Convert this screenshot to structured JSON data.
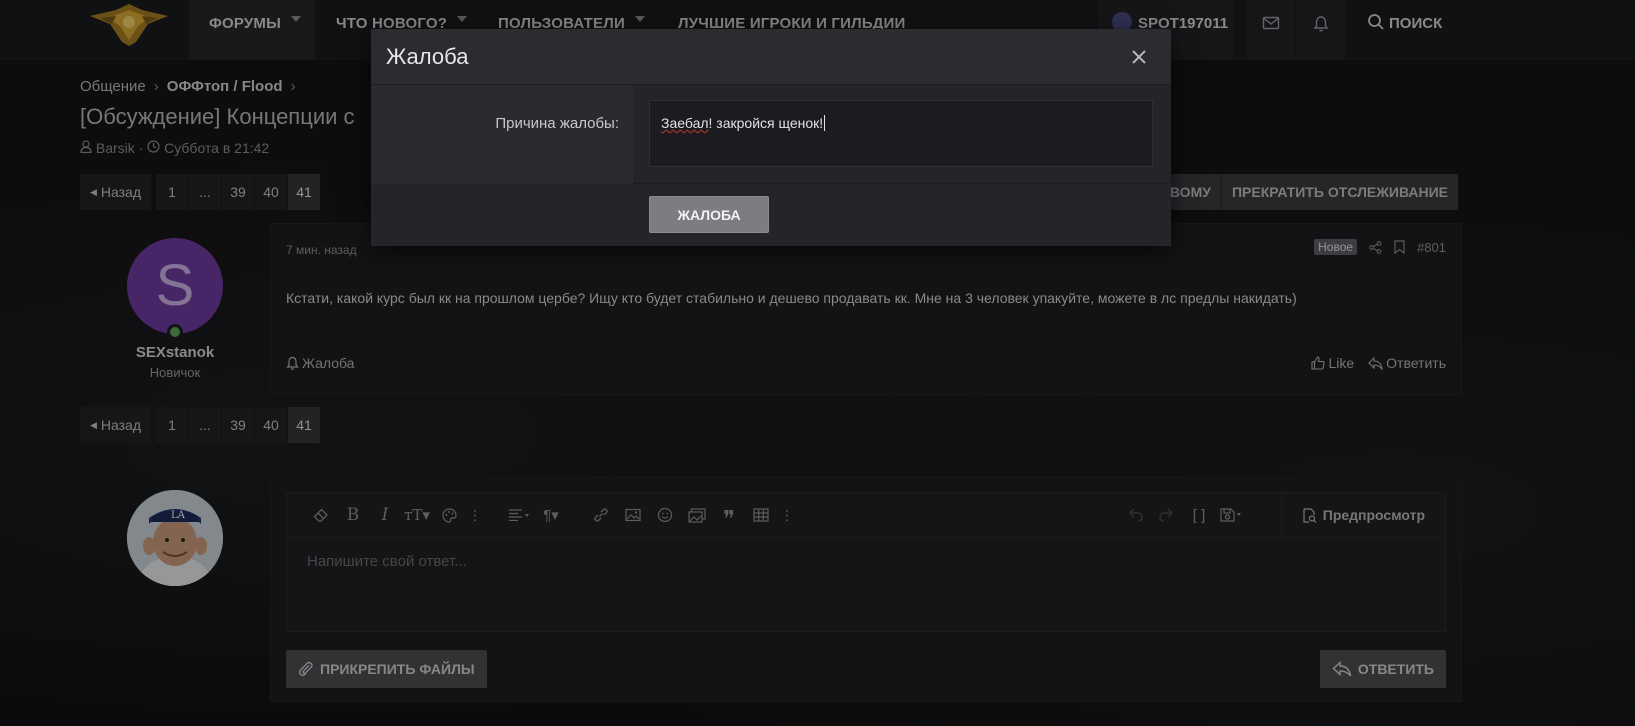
{
  "nav": {
    "tabs": [
      {
        "label": "ФОРУМЫ"
      },
      {
        "label": "ЧТО НОВОГО?"
      },
      {
        "label": "ПОЛЬЗОВАТЕЛИ"
      },
      {
        "label": "ЛУЧШИЕ ИГРОКИ И ГИЛЬДИИ"
      }
    ],
    "username": "SPOT197011",
    "search_label": "ПОИСК",
    "icons": [
      "logo",
      "mail-icon",
      "bell-icon",
      "search-icon"
    ]
  },
  "breadcrumb": {
    "items": [
      "Общение",
      "ОФФтоп / Flood"
    ]
  },
  "thread": {
    "title": "[Обсуждение] Концепции с",
    "author": "Barsik",
    "date": "Суббота в 21:42"
  },
  "pager": {
    "back_label": "Назад",
    "pages": [
      "1",
      "...",
      "39",
      "40",
      "41"
    ],
    "active": "41"
  },
  "watch_buttons": [
    "ВОМУ",
    "ПРЕКРАТИТЬ ОТСЛЕЖИВАНИЕ"
  ],
  "post": {
    "avatar_letter": "S",
    "username": "SEXstanok",
    "user_title": "Новичок",
    "time": "7 мин. назад",
    "badge": "Новое",
    "number": "#801",
    "text": "Кстати, какой курс был кк на прошлом цербе? Ищу кто будет стабильно и дешево продавать кк. Мне на 3 человек упакуйте, можете в лс предлы накидать)",
    "report_label": "Жалоба",
    "like_label": "Like",
    "reply_label": "Ответить"
  },
  "editor": {
    "placeholder": "Напишите свой ответ...",
    "preview_label": "Предпросмотр",
    "attach_label": "ПРИКРЕПИТЬ ФАЙЛЫ",
    "submit_label": "ОТВЕТИТЬ"
  },
  "modal": {
    "title": "Жалоба",
    "field_label": "Причина жалобы:",
    "field_value_word1": "Заебал",
    "field_value_rest": "! закройся щенок!",
    "submit_label": "ЖАЛОБА"
  },
  "colors": {
    "avatar_bg": "#6e3ba0",
    "online": "#5fa15b",
    "accent_gray": "#7c7c82"
  }
}
